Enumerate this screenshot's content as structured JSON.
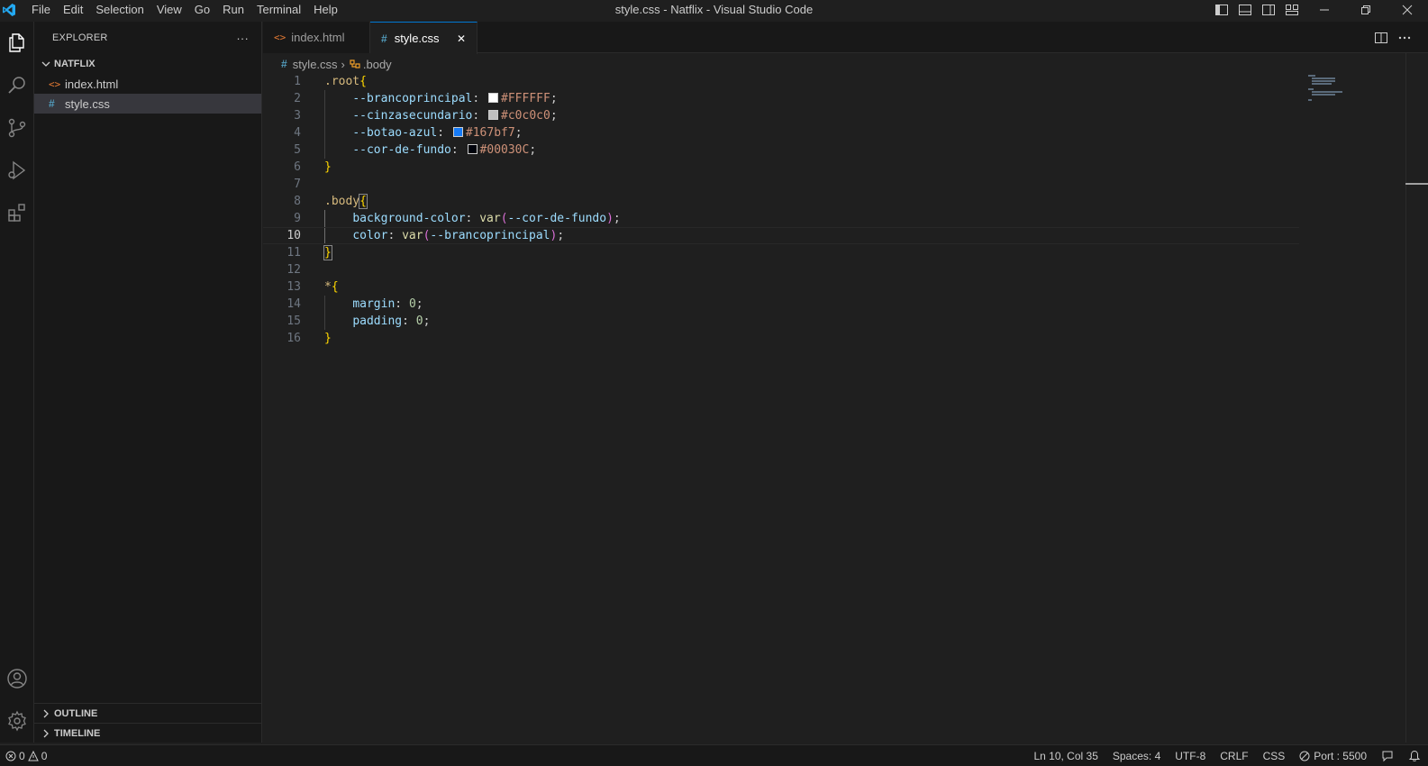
{
  "window": {
    "title": "style.css - Natflix - Visual Studio Code"
  },
  "menu": [
    "File",
    "Edit",
    "Selection",
    "View",
    "Go",
    "Run",
    "Terminal",
    "Help"
  ],
  "explorer": {
    "header": "EXPLORER",
    "more": "···",
    "folder": "NATFLIX",
    "files": [
      {
        "name": "index.html",
        "type": "html",
        "icon_glyph": "<>"
      },
      {
        "name": "style.css",
        "type": "css",
        "icon_glyph": "#"
      }
    ],
    "outline": "OUTLINE",
    "timeline": "TIMELINE"
  },
  "tabs": [
    {
      "label": "index.html",
      "icon_glyph": "<>",
      "active": false
    },
    {
      "label": "style.css",
      "icon_glyph": "#",
      "active": true,
      "close": "✕"
    }
  ],
  "breadcrumb": {
    "file": "style.css",
    "file_glyph": "#",
    "symbol": ".body",
    "separator": "›"
  },
  "editor": {
    "current_line": 10,
    "line_numbers": [
      "1",
      "2",
      "3",
      "4",
      "5",
      "6",
      "7",
      "8",
      "9",
      "10",
      "11",
      "12",
      "13",
      "14",
      "15",
      "16"
    ],
    "root_sel": ".root",
    "body_sel": ".body",
    "star_sel": "*",
    "open_brace": "{",
    "close_brace": "}",
    "vars": [
      {
        "name": "--brancoprincipal",
        "value": "#FFFFFF",
        "swatch": "#FFFFFF"
      },
      {
        "name": "--cinzasecundario",
        "value": "#c0c0c0",
        "swatch": "#c0c0c0"
      },
      {
        "name": "--botao-azul",
        "value": "#167bf7",
        "swatch": "#167bf7"
      },
      {
        "name": "--cor-de-fundo",
        "value": "#00030C",
        "swatch": "#00030C"
      }
    ],
    "body_props": [
      {
        "prop": "background-color",
        "fn": "var",
        "arg": "--cor-de-fundo"
      },
      {
        "prop": "color",
        "fn": "var",
        "arg": "--brancoprincipal"
      }
    ],
    "star_props": [
      {
        "prop": "margin",
        "value": "0"
      },
      {
        "prop": "padding",
        "value": "0"
      }
    ]
  },
  "status": {
    "errors": "0",
    "warnings": "0",
    "position": "Ln 10, Col 35",
    "spaces": "Spaces: 4",
    "encoding": "UTF-8",
    "eol": "CRLF",
    "language": "CSS",
    "port": "Port : 5500"
  },
  "colors": {
    "accent": "#0078d4",
    "background": "#1f1f1f",
    "sidebar": "#181818"
  }
}
